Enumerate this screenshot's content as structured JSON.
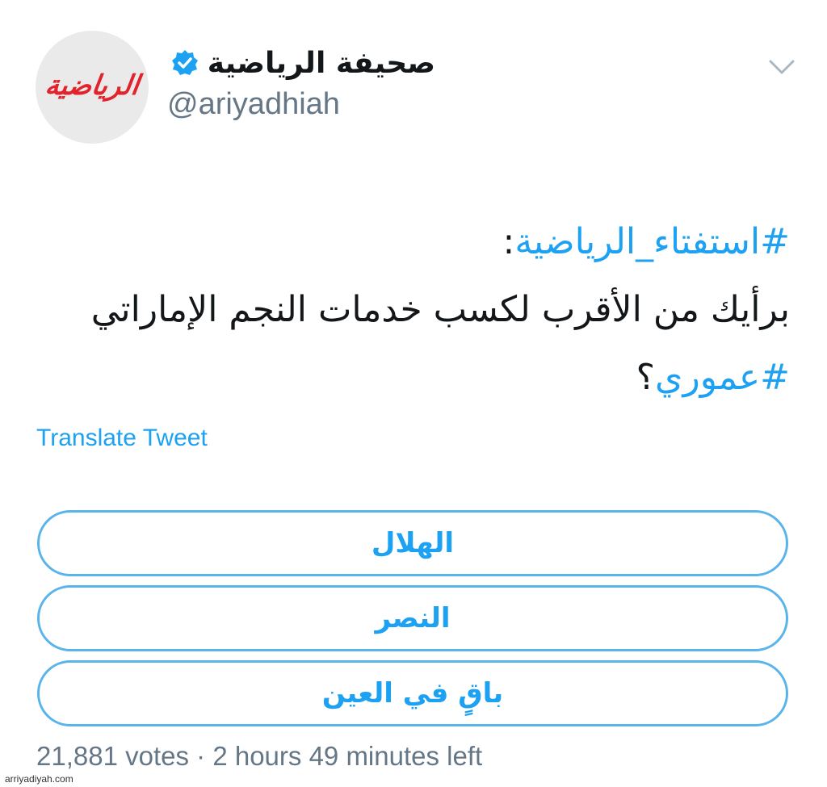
{
  "account": {
    "display_name": "صحيفة الرياضية",
    "handle": "@ariyadhiah",
    "avatar_logo_text": "الرياضية",
    "verified_icon": "verified-badge-icon",
    "menu_icon": "chevron-down-icon"
  },
  "tweet": {
    "hashtag_poll": "#استفتاء_الرياضية",
    "colon": ":",
    "body": "برأيك من الأقرب لكسب خدمات النجم الإماراتي",
    "hashtag_player": "#عموري",
    "question_mark": "؟"
  },
  "translate_label": "Translate Tweet",
  "poll": {
    "options": [
      "الهلال",
      "النصر",
      "باقٍ في العين"
    ],
    "votes": "21,881 votes",
    "separator": "·",
    "time_left": "2 hours 49 minutes left"
  },
  "watermark": "arriyadiyah.com",
  "colors": {
    "accent": "#1da1f2",
    "poll_border": "#5ab4ec",
    "secondary_text": "#657786",
    "logo_red": "#e3232b"
  }
}
